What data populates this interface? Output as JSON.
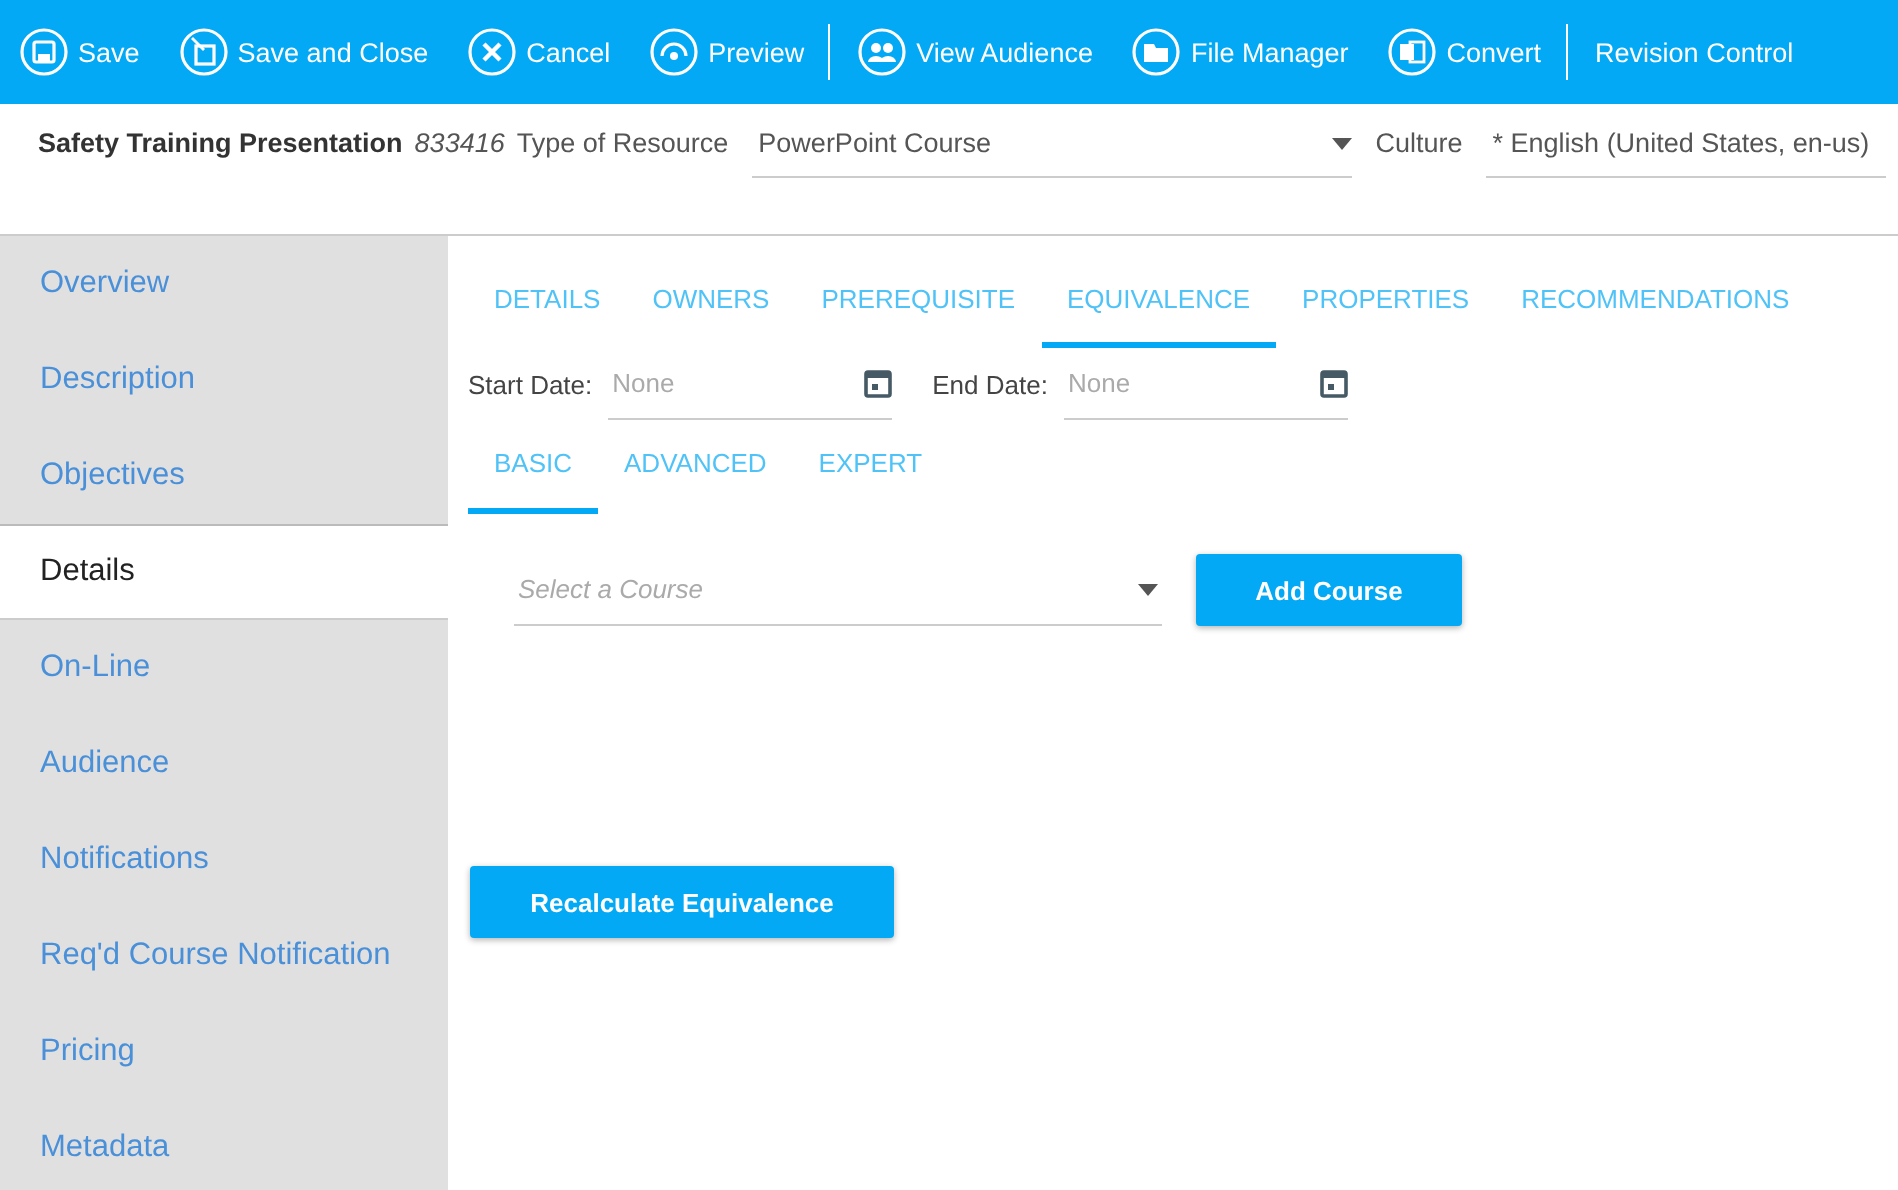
{
  "toolbar": [
    {
      "label": "Save",
      "divider_before": false
    },
    {
      "label": "Save and Close",
      "divider_before": false
    },
    {
      "label": "Cancel",
      "divider_before": false
    },
    {
      "label": "Preview",
      "divider_before": false
    },
    {
      "label": "View Audience",
      "divider_before": true
    },
    {
      "label": "File Manager",
      "divider_before": false
    },
    {
      "label": "Convert",
      "divider_before": false
    },
    {
      "label": "Revision Control",
      "divider_before": true
    }
  ],
  "header": {
    "title": "Safety Training Presentation",
    "id": "833416",
    "type_label": "Type of Resource",
    "type_value": "PowerPoint Course",
    "culture_label": "Culture",
    "culture_value": "* English (United States, en-us)"
  },
  "sidebar": {
    "items": [
      {
        "label": "Overview",
        "selected": false
      },
      {
        "label": "Description",
        "selected": false
      },
      {
        "label": "Objectives",
        "selected": false
      },
      {
        "label": "Details",
        "selected": true
      },
      {
        "label": "On-Line",
        "selected": false
      },
      {
        "label": "Audience",
        "selected": false
      },
      {
        "label": "Notifications",
        "selected": false
      },
      {
        "label": "Req'd Course Notification",
        "selected": false
      },
      {
        "label": "Pricing",
        "selected": false
      },
      {
        "label": "Metadata",
        "selected": false
      }
    ]
  },
  "tabs": [
    {
      "label": "DETAILS",
      "selected": false
    },
    {
      "label": "OWNERS",
      "selected": false
    },
    {
      "label": "PREREQUISITE",
      "selected": false
    },
    {
      "label": "EQUIVALENCE",
      "selected": true
    },
    {
      "label": "PROPERTIES",
      "selected": false
    },
    {
      "label": "RECOMMENDATIONS",
      "selected": false
    }
  ],
  "dates": [
    {
      "label": "Start Date:",
      "placeholder": "None"
    },
    {
      "label": "End Date:",
      "placeholder": "None"
    }
  ],
  "subtabs": [
    {
      "label": "BASIC",
      "selected": true
    },
    {
      "label": "ADVANCED",
      "selected": false
    },
    {
      "label": "EXPERT",
      "selected": false
    }
  ],
  "course_select": {
    "placeholder": "Select a Course"
  },
  "add_button": "Add Course",
  "recalc_button": "Recalculate Equivalence"
}
